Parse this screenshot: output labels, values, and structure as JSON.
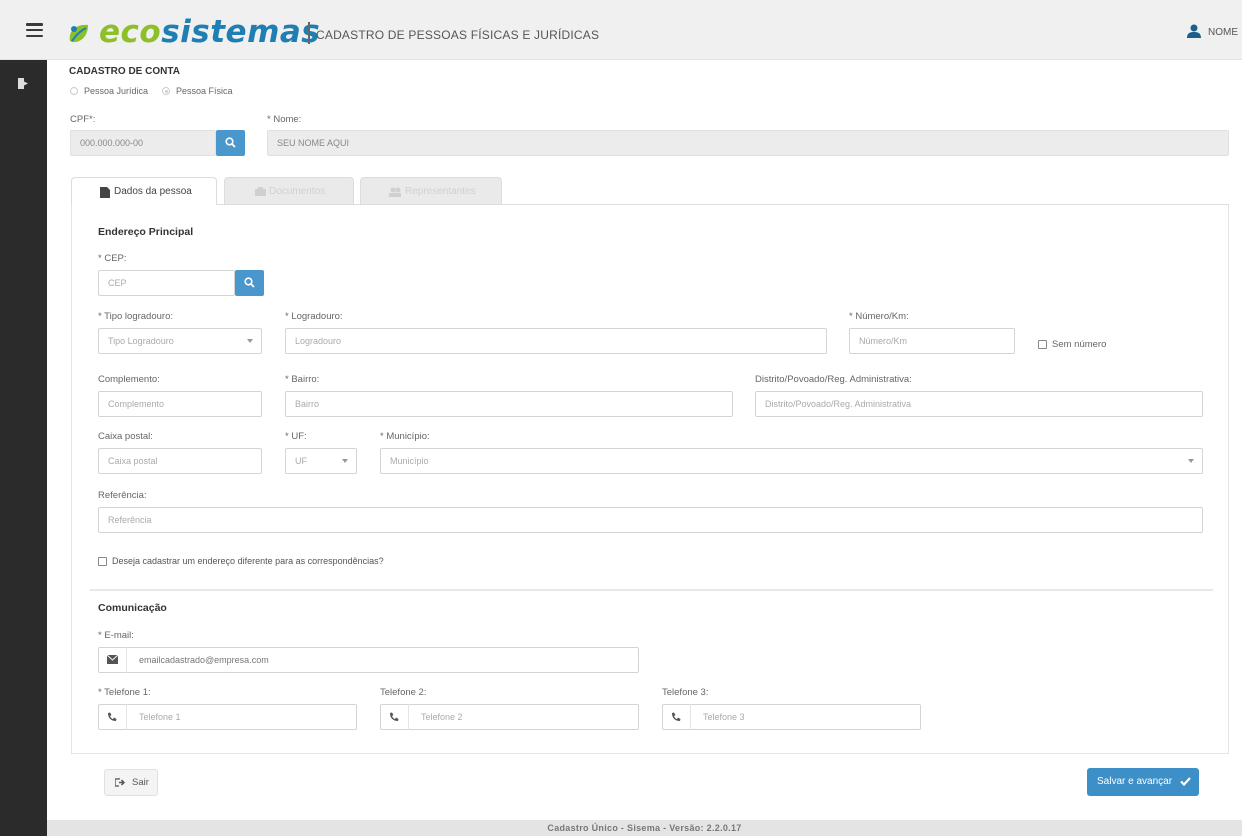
{
  "header": {
    "logo_eco": "eco",
    "logo_sis": "sistemas",
    "subtitle": "Cadastro de Pessoas Físicas e Jurídicas",
    "user_name": "NOME"
  },
  "account": {
    "title": "CADASTRO DE CONTA",
    "radio_juridica": "Pessoa Jurídica",
    "radio_fisica": "Pessoa Física",
    "cpf_label": "CPF*:",
    "cpf_value": "000.000.000-00",
    "nome_label": "* Nome:",
    "nome_value": "SEU NOME AQUI"
  },
  "tabs": {
    "dados": "Dados da pessoa",
    "documentos": "Documentos",
    "representantes": "Representantes"
  },
  "endereco": {
    "title": "Endereço Principal",
    "cep_label": "* CEP:",
    "cep_placeholder": "CEP",
    "tipo_label": "* Tipo logradouro:",
    "tipo_placeholder": "Tipo Logradouro",
    "logradouro_label": "* Logradouro:",
    "logradouro_placeholder": "Logradouro",
    "numero_label": "* Número/Km:",
    "numero_placeholder": "Número/Km",
    "sem_numero": "Sem número",
    "complemento_label": "Complemento:",
    "complemento_placeholder": "Complemento",
    "bairro_label": "* Bairro:",
    "bairro_placeholder": "Bairro",
    "distrito_label": "Distrito/Povoado/Reg. Administrativa:",
    "distrito_placeholder": "Distrito/Povoado/Reg. Administrativa",
    "caixa_label": "Caixa postal:",
    "caixa_placeholder": "Caixa postal",
    "uf_label": "* UF:",
    "uf_placeholder": "UF",
    "municipio_label": "* Município:",
    "municipio_placeholder": "Município",
    "referencia_label": "Referência:",
    "referencia_placeholder": "Referência",
    "correspondencia": "Deseja cadastrar um endereço diferente para as correspondências?"
  },
  "comunicacao": {
    "title": "Comunicação",
    "email_label": "* E-mail:",
    "email_value": "emailcadastrado@empresa.com",
    "tel1_label": "* Telefone 1:",
    "tel1_placeholder": "Telefone 1",
    "tel2_label": "Telefone 2:",
    "tel2_placeholder": "Telefone 2",
    "tel3_label": "Telefone 3:",
    "tel3_placeholder": "Telefone 3"
  },
  "actions": {
    "sair": "Sair",
    "salvar": "Salvar e avançar"
  },
  "footer": {
    "text": "Cadastro Único - Sisema - Versão: 2.2.0.17"
  },
  "colors": {
    "accent": "#3d8fc8",
    "logo_green": "#8dbf2a",
    "logo_blue": "#1f7fb3",
    "sidebar": "#2b2b2b"
  },
  "icons": [
    "menu-icon",
    "leaf-logo-icon",
    "user-icon",
    "exit-icon",
    "search-icon",
    "file-icon",
    "camera-icon",
    "users-icon",
    "envelope-icon",
    "phone-icon",
    "check-icon",
    "sign-out-icon"
  ]
}
